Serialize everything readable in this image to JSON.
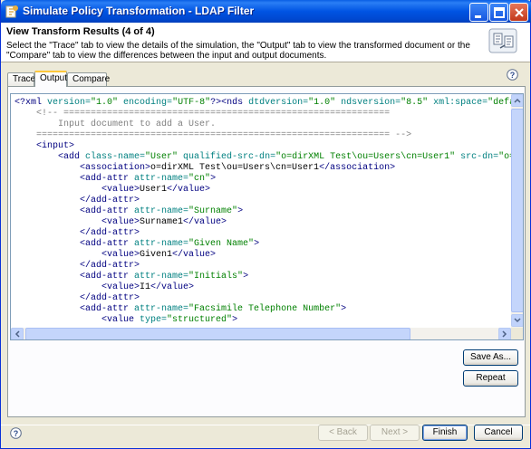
{
  "window": {
    "title": "Simulate Policy Transformation - LDAP Filter"
  },
  "header": {
    "title": "View Transform Results (4 of 4)",
    "description": "Select the \"Trace\" tab to view the details of the simulation, the \"Output\" tab to view the transformed document or the \"Compare\" tab to view the differences between the input and output documents."
  },
  "tabs": [
    {
      "label": "Trace",
      "active": false
    },
    {
      "label": "Output",
      "active": true
    },
    {
      "label": "Compare",
      "active": false
    }
  ],
  "code_lines": [
    [
      [
        "t",
        "<?xml "
      ],
      [
        "an",
        "version="
      ],
      [
        "av",
        "\"1.0\""
      ],
      [
        "an",
        " encoding="
      ],
      [
        "av",
        "\"UTF-8\""
      ],
      [
        "t",
        "?><nds "
      ],
      [
        "an",
        "dtdversion="
      ],
      [
        "av",
        "\"1.0\""
      ],
      [
        "an",
        " ndsversion="
      ],
      [
        "av",
        "\"8.5\""
      ],
      [
        "an",
        " xml:space="
      ],
      [
        "av",
        "\"default"
      ]
    ],
    [
      [
        "cm",
        "    <!-- ============================================================"
      ]
    ],
    [
      [
        "cm",
        "        Input document to add a User."
      ]
    ],
    [
      [
        "cm",
        "    ================================================================= -->"
      ]
    ],
    [
      [
        "t",
        "    <input>"
      ]
    ],
    [
      [
        "t",
        "        <add "
      ],
      [
        "an",
        "class-name="
      ],
      [
        "av",
        "\"User\""
      ],
      [
        "an",
        " qualified-src-dn="
      ],
      [
        "av",
        "\"o=dirXML Test\\ou=Users\\cn=User1\""
      ],
      [
        "an",
        " src-dn="
      ],
      [
        "av",
        "\"o=dir"
      ]
    ],
    [
      [
        "t",
        "            <association>"
      ],
      [
        "tx",
        "o=dirXML Test\\ou=Users\\cn=User1"
      ],
      [
        "t",
        "</association>"
      ]
    ],
    [
      [
        "t",
        "            <add-attr "
      ],
      [
        "an",
        "attr-name="
      ],
      [
        "av",
        "\"cn\""
      ],
      [
        "t",
        ">"
      ]
    ],
    [
      [
        "t",
        "                <value>"
      ],
      [
        "tx",
        "User1"
      ],
      [
        "t",
        "</value>"
      ]
    ],
    [
      [
        "t",
        "            </add-attr>"
      ]
    ],
    [
      [
        "t",
        "            <add-attr "
      ],
      [
        "an",
        "attr-name="
      ],
      [
        "av",
        "\"Surname\""
      ],
      [
        "t",
        ">"
      ]
    ],
    [
      [
        "t",
        "                <value>"
      ],
      [
        "tx",
        "Surname1"
      ],
      [
        "t",
        "</value>"
      ]
    ],
    [
      [
        "t",
        "            </add-attr>"
      ]
    ],
    [
      [
        "t",
        "            <add-attr "
      ],
      [
        "an",
        "attr-name="
      ],
      [
        "av",
        "\"Given Name\""
      ],
      [
        "t",
        ">"
      ]
    ],
    [
      [
        "t",
        "                <value>"
      ],
      [
        "tx",
        "Given1"
      ],
      [
        "t",
        "</value>"
      ]
    ],
    [
      [
        "t",
        "            </add-attr>"
      ]
    ],
    [
      [
        "t",
        "            <add-attr "
      ],
      [
        "an",
        "attr-name="
      ],
      [
        "av",
        "\"Initials\""
      ],
      [
        "t",
        ">"
      ]
    ],
    [
      [
        "t",
        "                <value>"
      ],
      [
        "tx",
        "I1"
      ],
      [
        "t",
        "</value>"
      ]
    ],
    [
      [
        "t",
        "            </add-attr>"
      ]
    ],
    [
      [
        "t",
        "            <add-attr "
      ],
      [
        "an",
        "attr-name="
      ],
      [
        "av",
        "\"Facsimile Telephone Number\""
      ],
      [
        "t",
        ">"
      ]
    ],
    [
      [
        "t",
        "                <value "
      ],
      [
        "an",
        "type="
      ],
      [
        "av",
        "\"structured\""
      ],
      [
        "t",
        ">"
      ]
    ]
  ],
  "buttons": {
    "save_as": "Save As...",
    "repeat": "Repeat",
    "back": "< Back",
    "next": "Next >",
    "finish": "Finish",
    "cancel": "Cancel"
  },
  "icons": {
    "app": "policy-icon",
    "help": "help-icon",
    "banner": "transform-document-icon"
  },
  "colors": {
    "titlebar": "#0054e3",
    "tag": "#000080",
    "attribute_name": "#008080",
    "attribute_value": "#008000",
    "comment": "#808080",
    "tab_highlight": "#ffc83c"
  }
}
